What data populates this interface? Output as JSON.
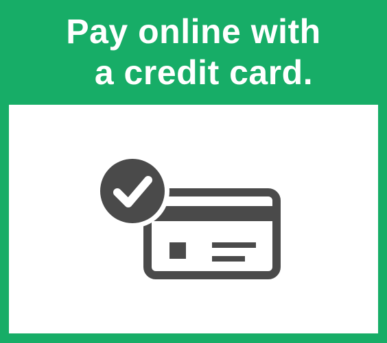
{
  "headline": {
    "line1": "Pay online with",
    "line2": "a credit card."
  },
  "icon": "credit-card-check-icon",
  "colors": {
    "brand_green": "#17ad67",
    "panel_background": "#ffffff",
    "icon_color": "#4a4a4a",
    "text_color": "#ffffff"
  }
}
